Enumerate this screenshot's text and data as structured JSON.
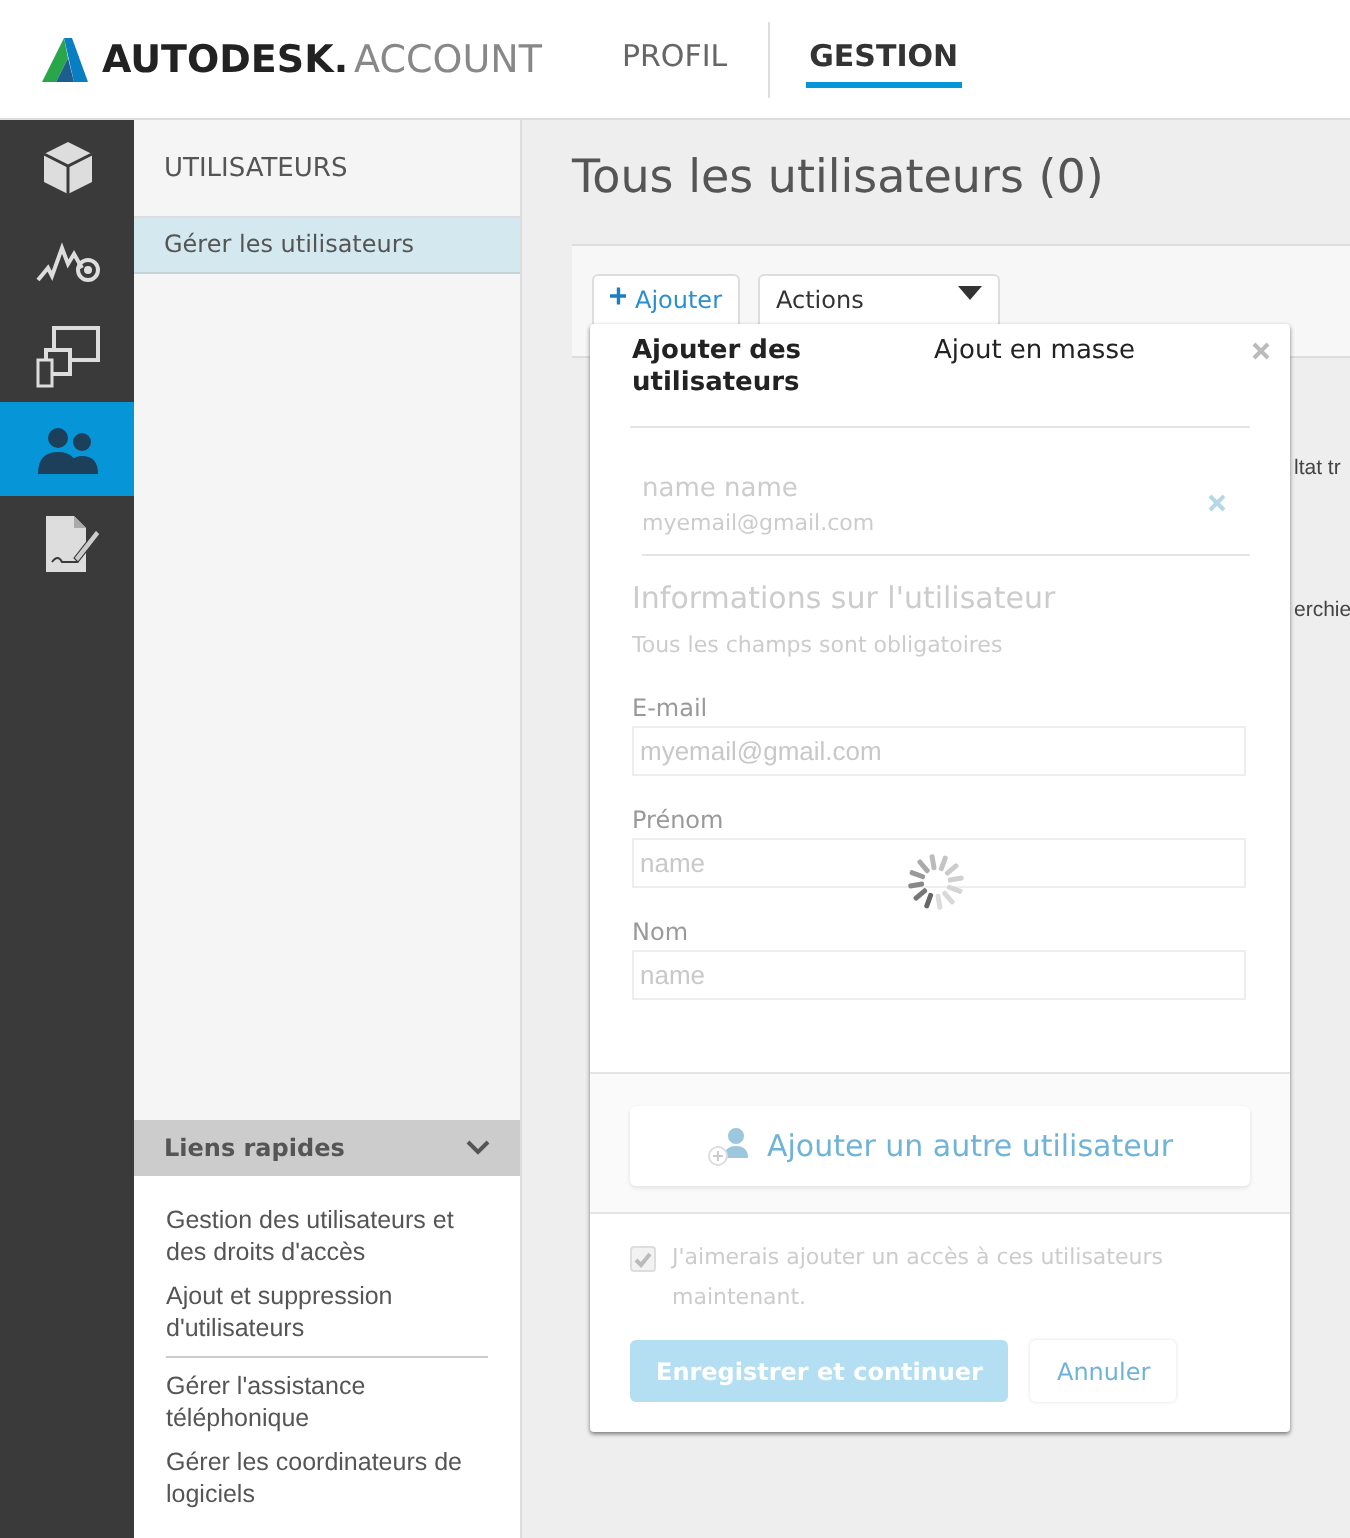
{
  "header": {
    "brand": "AUTODESK.",
    "product": "ACCOUNT",
    "nav": [
      {
        "label": "PROFIL",
        "selected": false
      },
      {
        "label": "GESTION",
        "selected": true
      }
    ]
  },
  "rail": [
    {
      "kind": "cube",
      "selected": false
    },
    {
      "kind": "usage",
      "selected": false
    },
    {
      "kind": "devices",
      "selected": false
    },
    {
      "kind": "users",
      "selected": true
    },
    {
      "kind": "contract",
      "selected": false
    }
  ],
  "sidebar": {
    "title": "UTILISATEURS",
    "items": [
      {
        "label": "Gérer les utilisateurs",
        "selected": true
      }
    ],
    "quick_links": {
      "title": "Liens rapides",
      "expanded": true,
      "groups": [
        [
          "Gestion des utilisateurs et des droits d'accès",
          "Ajout et suppression d'utilisateurs"
        ],
        [
          "Gérer l'assistance téléphonique",
          "Gérer les coordinateurs de logiciels"
        ]
      ]
    }
  },
  "main": {
    "title": "Tous les utilisateurs (0)",
    "add_button": "Ajouter",
    "actions_dropdown": "Actions",
    "hidden_texts": [
      "ltat tr",
      "erchie"
    ]
  },
  "modal": {
    "tabs": [
      {
        "label": "Ajouter des utilisateurs",
        "selected": true
      },
      {
        "label": "Ajout en masse",
        "selected": false
      }
    ],
    "entry": {
      "name": "name name",
      "email": "myemail@gmail.com"
    },
    "section_title": "Informations sur l'utilisateur",
    "note": "Tous les champs sont obligatoires",
    "fields": [
      {
        "label": "E-mail",
        "value": "myemail@gmail.com"
      },
      {
        "label": "Prénom",
        "value": "name"
      },
      {
        "label": "Nom",
        "value": "name"
      }
    ],
    "loading": true,
    "add_another": "Ajouter un autre utilisateur",
    "consent": {
      "label": "J'aimerais ajouter un accès à ces utilisateurs maintenant.",
      "checked": true
    },
    "buttons": [
      {
        "label": "Enregistrer et continuer",
        "kind": "primary"
      },
      {
        "label": "Annuler",
        "kind": "secondary"
      }
    ]
  }
}
